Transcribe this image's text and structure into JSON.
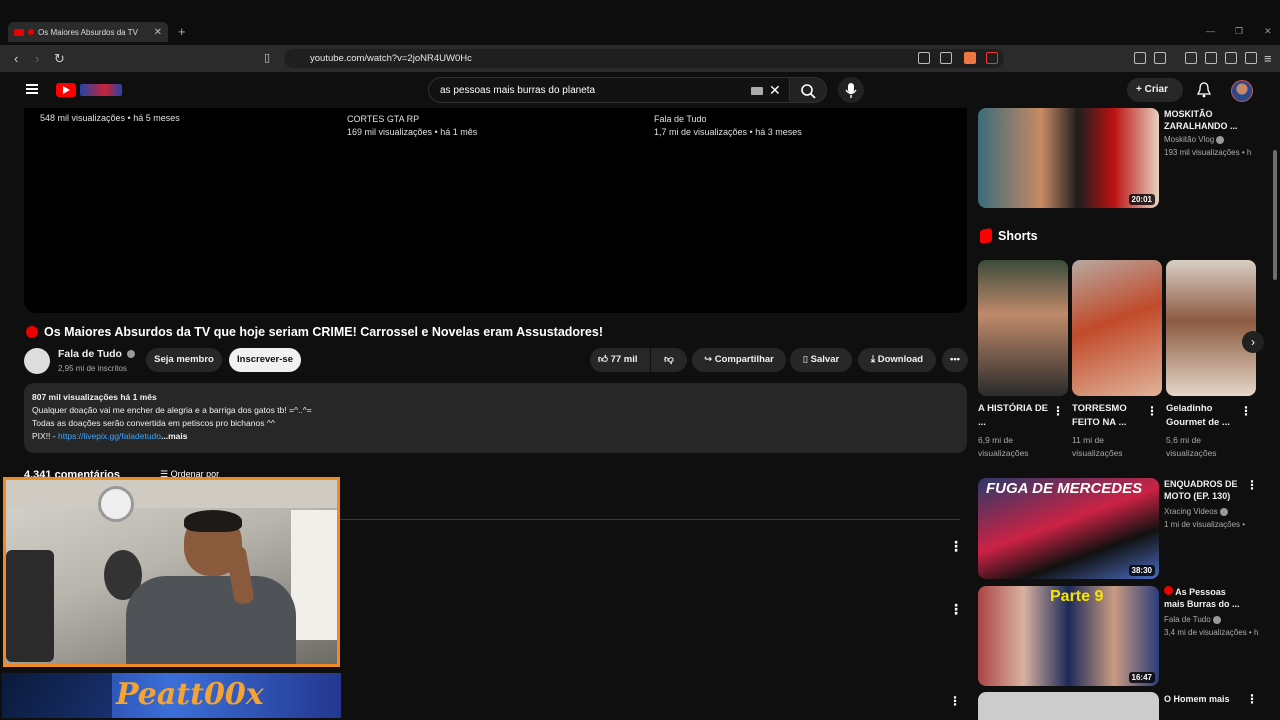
{
  "browser": {
    "tab_title": "Os Maiores Absurdos da TV",
    "tab_close": "✕",
    "new_tab": "+",
    "url": "youtube.com/watch?v=2joNR4UW0Hc"
  },
  "header": {
    "search_query": "as pessoas mais burras do planeta",
    "create_label": "Criar"
  },
  "prev_row": [
    {
      "channel": "",
      "title_fragment": "",
      "meta": "548 mil visualizações • há 5 meses"
    },
    {
      "channel": "CORTES GTA RP",
      "meta": "169 mil visualizações • há 1 mês"
    },
    {
      "channel": "Fala de Tudo",
      "meta": "1,7 mi de visualizações • há 3 meses"
    }
  ],
  "video": {
    "title": "Os Maiores Absurdos da TV que hoje seriam CRIME! Carrossel e Novelas eram Assustadores!",
    "channel": "Fala de Tudo",
    "subscribers": "2,95 mi de inscritos",
    "member_label": "Seja membro",
    "subscribe_label": "Inscrever-se",
    "likes": "77 mil",
    "share_label": "Compartilhar",
    "save_label": "Salvar",
    "download_label": "Download"
  },
  "description": {
    "stats": "807 mil visualizações  há 1 mês",
    "line1": "Qualquer doação vai me encher de alegria e a barriga dos gatos tb!  =^..^=",
    "line2": "Todas as doações serão convertida em petiscos pro bichanos ^^",
    "line3_prefix": "PIX!! - ",
    "link": "https://livepix.gg/faladetudo",
    "more": "...mais"
  },
  "comments": {
    "count_label": "4.341 comentários",
    "sort_label": "Ordenar por"
  },
  "overlay": {
    "banner_text": "Peatt00x"
  },
  "sidebar": {
    "top_video": {
      "title": "MOSKITÃO ZARALHANDO ...",
      "channel": "Moskitão Vlog",
      "meta": "193 mil visualizações • h",
      "duration": "20:01"
    },
    "shorts_label": "Shorts",
    "shorts": [
      {
        "title": "A HISTÓRIA DE ...",
        "views": "6,9 mi de visualizações"
      },
      {
        "title": "TORRESMO FEITO NA ...",
        "views": "11 mi de visualizações"
      },
      {
        "title": "Geladinho Gourmet de ...",
        "views": "5,6 mi de visualizações"
      }
    ],
    "videos": [
      {
        "title": "ENQUADROS DE MOTO (EP. 130)",
        "channel": "Xracing Videos",
        "meta": "1 mi de visualizações • ",
        "duration": "38:30",
        "thumb_text": "FUGA DE MERCEDES"
      },
      {
        "title": "As Pessoas mais Burras do ...",
        "channel": "Fala de Tudo",
        "meta": "3,4 mi de visualizações • h",
        "duration": "16:47",
        "thumb_text": "Parte 9"
      },
      {
        "title": "O Homem mais",
        "channel": "",
        "meta": "",
        "duration": ""
      }
    ]
  }
}
